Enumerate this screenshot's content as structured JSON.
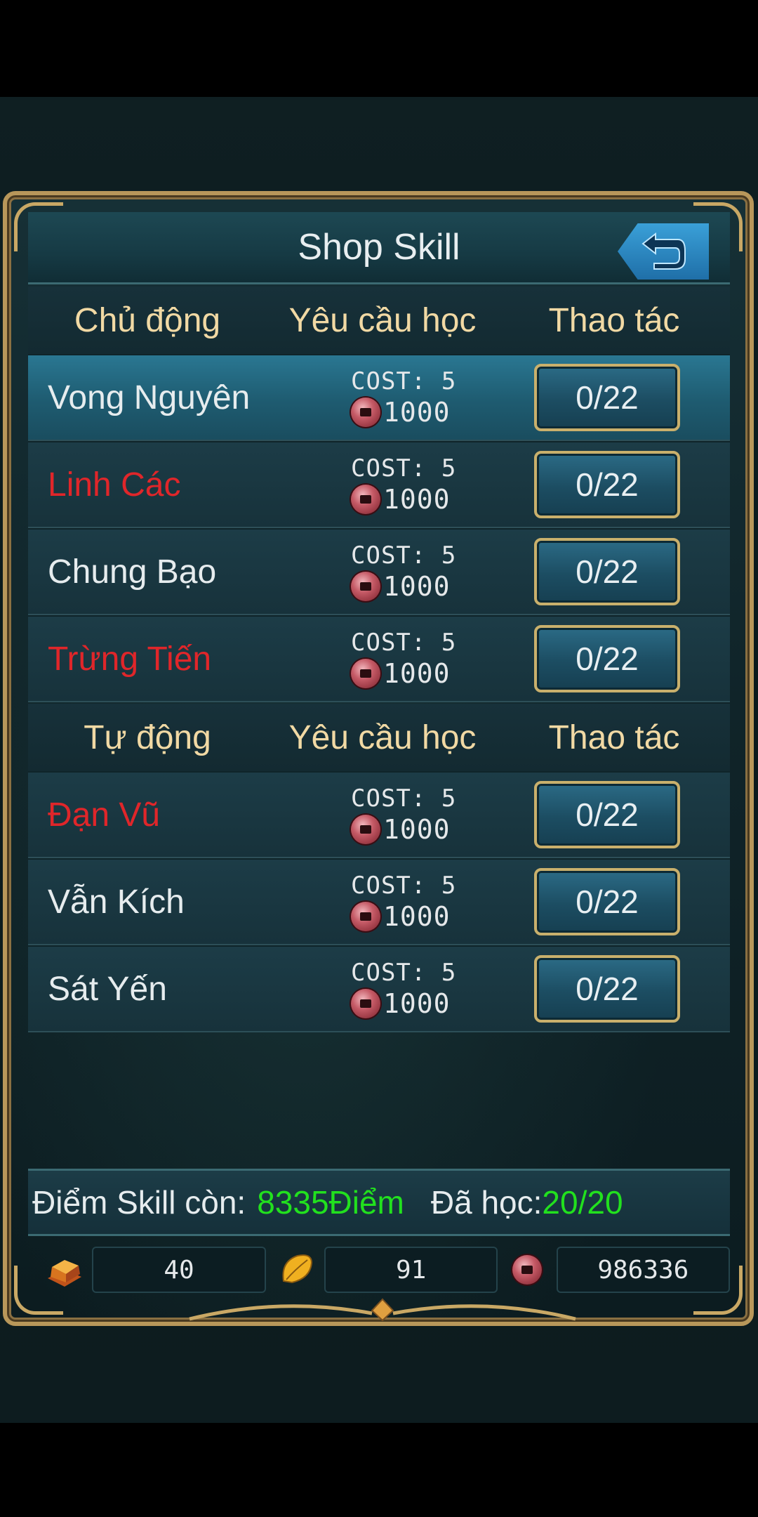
{
  "header": {
    "title": "Shop Skill"
  },
  "active_section": {
    "headers": {
      "name": "Chủ động",
      "requirement": "Yêu cầu học",
      "action": "Thao tác"
    },
    "skills": [
      {
        "name": "Vong Nguyên",
        "color": "#e6ecee",
        "cost": "COST: 5",
        "price": "1000",
        "progress": "0/22"
      },
      {
        "name": "Linh Các",
        "color": "#e0262a",
        "cost": "COST: 5",
        "price": "1000",
        "progress": "0/22"
      },
      {
        "name": "Chung Bạo",
        "color": "#e6ecee",
        "cost": "COST: 5",
        "price": "1000",
        "progress": "0/22"
      },
      {
        "name": "Trừng Tiến",
        "color": "#e0262a",
        "cost": "COST: 5",
        "price": "1000",
        "progress": "0/22"
      }
    ]
  },
  "passive_section": {
    "headers": {
      "name": "Tự động",
      "requirement": "Yêu cầu học",
      "action": "Thao tác"
    },
    "skills": [
      {
        "name": "Đạn Vũ",
        "color": "#e0262a",
        "cost": "COST: 5",
        "price": "1000",
        "progress": "0/22"
      },
      {
        "name": "Vẫn Kích",
        "color": "#e6ecee",
        "cost": "COST: 5",
        "price": "1000",
        "progress": "0/22"
      },
      {
        "name": "Sát Yến",
        "color": "#e6ecee",
        "cost": "COST: 5",
        "price": "1000",
        "progress": "0/22"
      }
    ]
  },
  "status": {
    "points_label": "Điểm Skill còn:",
    "points_value": "8335Điểm",
    "learned_label": "Đã học:",
    "learned_value": "20/20"
  },
  "currency": {
    "gold": "40",
    "leaf": "91",
    "coin": "986336"
  },
  "colors": {
    "accent_green": "#22e11e",
    "danger_red": "#e0262a",
    "frame_gold": "#b8975a"
  }
}
